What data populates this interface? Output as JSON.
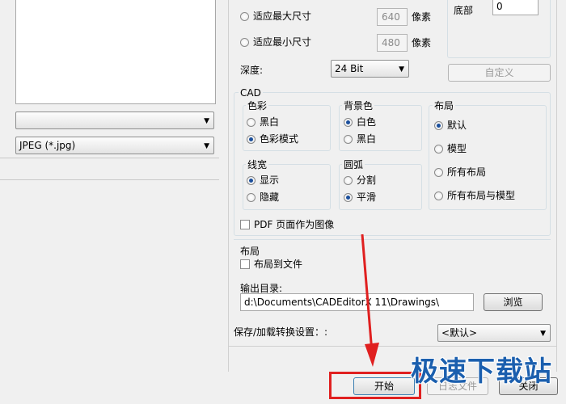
{
  "left_panel": {
    "combo_empty": "",
    "format_select": "JPEG (*.jpg)"
  },
  "size": {
    "fit_max_label": "适应最大尺寸",
    "fit_max_value": "640",
    "fit_max_unit": "像素",
    "fit_min_label": "适应最小尺寸",
    "fit_min_value": "480",
    "fit_min_unit": "像素",
    "depth_label": "深度:",
    "depth_value": "24 Bit"
  },
  "margins": {
    "bottom_label": "底部",
    "bottom_value": "0",
    "custom_button": "自定义"
  },
  "cad": {
    "title": "CAD",
    "color": {
      "title": "色彩",
      "options": [
        "黑白",
        "色彩模式"
      ],
      "selected": 1
    },
    "background": {
      "title": "背景色",
      "options": [
        "白色",
        "黑白"
      ],
      "selected": 0
    },
    "layout": {
      "title": "布局",
      "options": [
        "默认",
        "模型",
        "所有布局",
        "所有布局与模型"
      ],
      "selected": 0
    },
    "linewidth": {
      "title": "线宽",
      "options": [
        "显示",
        "隐藏"
      ],
      "selected": 0
    },
    "arc": {
      "title": "圆弧",
      "options": [
        "分割",
        "平滑"
      ],
      "selected": 1
    },
    "pdf_as_image": "PDF 页面作为图像"
  },
  "layout_section": {
    "title": "布局",
    "layout_to_file": "布局到文件"
  },
  "output": {
    "label": "输出目录:",
    "path": "d:\\Documents\\CADEditorX 11\\Drawings\\",
    "browse": "浏览"
  },
  "save_settings": {
    "label": "保存/加载转换设置：:",
    "value": "<默认>"
  },
  "buttons": {
    "start": "开始",
    "log": "日志文件",
    "close": "关闭"
  },
  "watermark": "极速下载站",
  "colors": {
    "highlight_red": "#e02020",
    "radio_dot": "#1b4f9c",
    "watermark": "#1b5fae"
  }
}
